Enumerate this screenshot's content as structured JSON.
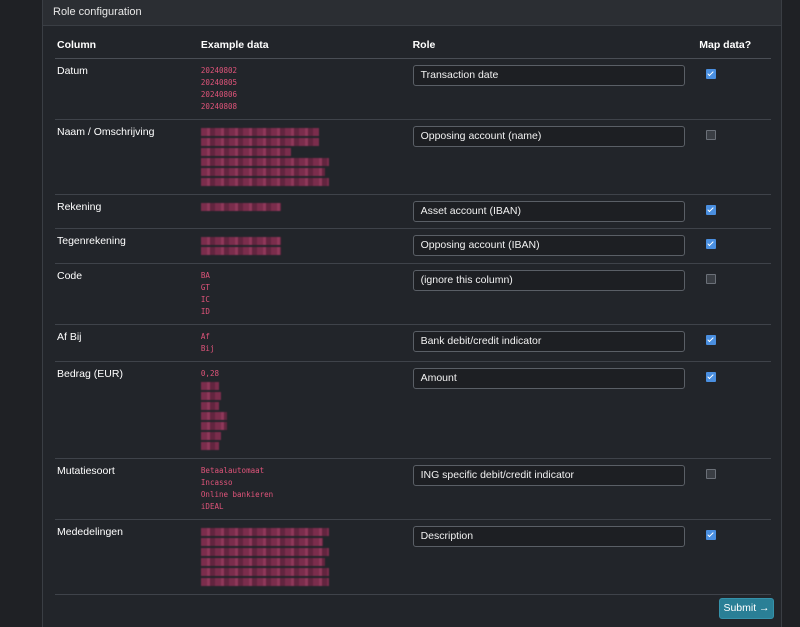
{
  "panel": {
    "title": "Role configuration"
  },
  "table": {
    "headers": {
      "column": "Column",
      "example": "Example data",
      "role": "Role",
      "map": "Map data?"
    },
    "rows": [
      {
        "name": "Datum",
        "examples": [
          "20240802",
          "20240805",
          "20240806",
          "20240808"
        ],
        "blurred": [],
        "role": "Transaction date",
        "map": true
      },
      {
        "name": "Naam / Omschrijving",
        "examples": [],
        "blurred": [
          118,
          118,
          90,
          128,
          124,
          128
        ],
        "role": "Opposing account (name)",
        "map": false
      },
      {
        "name": "Rekening",
        "examples": [],
        "blurred": [
          80
        ],
        "role": "Asset account (IBAN)",
        "map": true
      },
      {
        "name": "Tegenrekening",
        "examples": [],
        "blurred": [
          80,
          80
        ],
        "role": "Opposing account (IBAN)",
        "map": true
      },
      {
        "name": "Code",
        "examples": [
          "BA",
          "GT",
          "IC",
          "ID"
        ],
        "blurred": [],
        "role": "(ignore this column)",
        "map": false
      },
      {
        "name": "Af Bij",
        "examples": [
          "Af",
          "Bij"
        ],
        "blurred": [],
        "role": "Bank debit/credit indicator",
        "map": true
      },
      {
        "name": "Bedrag (EUR)",
        "examples": [
          "0,28"
        ],
        "blurred": [
          18,
          20,
          18,
          26,
          26,
          20,
          18
        ],
        "role": "Amount",
        "map": true
      },
      {
        "name": "Mutatiesoort",
        "examples": [
          "Betaalautomaat",
          "Incasso",
          "Online bankieren",
          "iDEAL"
        ],
        "blurred": [],
        "role": "ING specific debit/credit indicator",
        "map": false
      },
      {
        "name": "Mededelingen",
        "examples": [],
        "blurred": [
          128,
          122,
          128,
          124,
          128,
          128
        ],
        "role": "Description",
        "map": true
      }
    ]
  },
  "submit": {
    "label": "Submit →"
  }
}
